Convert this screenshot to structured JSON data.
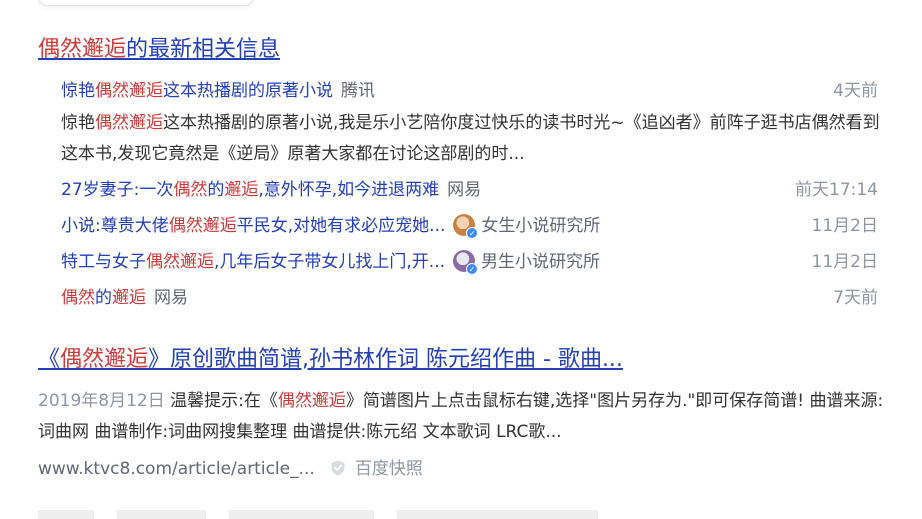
{
  "news_block": {
    "title_highlight": "偶然邂逅",
    "title_rest": "的最新相关信息",
    "items": [
      {
        "title_pre": "惊艳",
        "title_hl": "偶然邂逅",
        "title_post": "这本热播剧的原著小说",
        "source": "腾讯",
        "time": "4天前"
      },
      {
        "title_pre": "27岁妻子:一次",
        "title_hl": "偶然",
        "title_mid": "的",
        "title_hl2": "邂逅",
        "title_post": ",意外怀孕,如今进退两难",
        "source": "网易",
        "time": "前天17:14"
      },
      {
        "title_pre": "小说:尊贵大佬",
        "title_hl": "偶然邂逅",
        "title_post": "平民女,对她有求必应宠她...",
        "author": "女生小说研究所",
        "avatar_icon": "female-avatar-icon",
        "time": "11月2日"
      },
      {
        "title_pre": "特工与女子",
        "title_hl": "偶然邂逅",
        "title_post": ",几年后女子带女儿找上门,开...",
        "author": "男生小说研究所",
        "avatar_icon": "male-avatar-icon",
        "time": "11月2日"
      },
      {
        "title_hl": "偶然",
        "title_mid": "的",
        "title_hl2": "邂逅",
        "source": "网易",
        "time": "7天前"
      }
    ],
    "abstract_pre": "惊艳",
    "abstract_hl": "偶然邂逅",
    "abstract_post": "这本热播剧的原著小说,我是乐小艺陪你度过快乐的读书时光~《追凶者》前阵子逛书店偶然看到这本书,发现它竟然是《逆局》原著大家都在讨论这部剧的时..."
  },
  "result2": {
    "title_pre": "《",
    "title_hl": "偶然邂逅",
    "title_post": "》原创歌曲简谱,孙书林作词 陈元绍作曲 - 歌曲...",
    "date": "2019年8月12日",
    "abstract_pre": "温馨提示:在《",
    "abstract_hl": "偶然邂逅",
    "abstract_post": "》简谱图片上点击鼠标右键,选择\"图片另存为.\"即可保存简谱! 曲谱来源:词曲网 曲谱制作:词曲网搜集整理 曲谱提供:陈元绍 文本歌词 LRC歌...",
    "url": "www.ktvc8.com/article/article_...",
    "snapshot": "百度快照"
  },
  "colors": {
    "link": "#2440b3",
    "highlight": "#c93c3c",
    "meta": "#9195a3",
    "source": "#626675",
    "verified": "#3b8bf2"
  }
}
